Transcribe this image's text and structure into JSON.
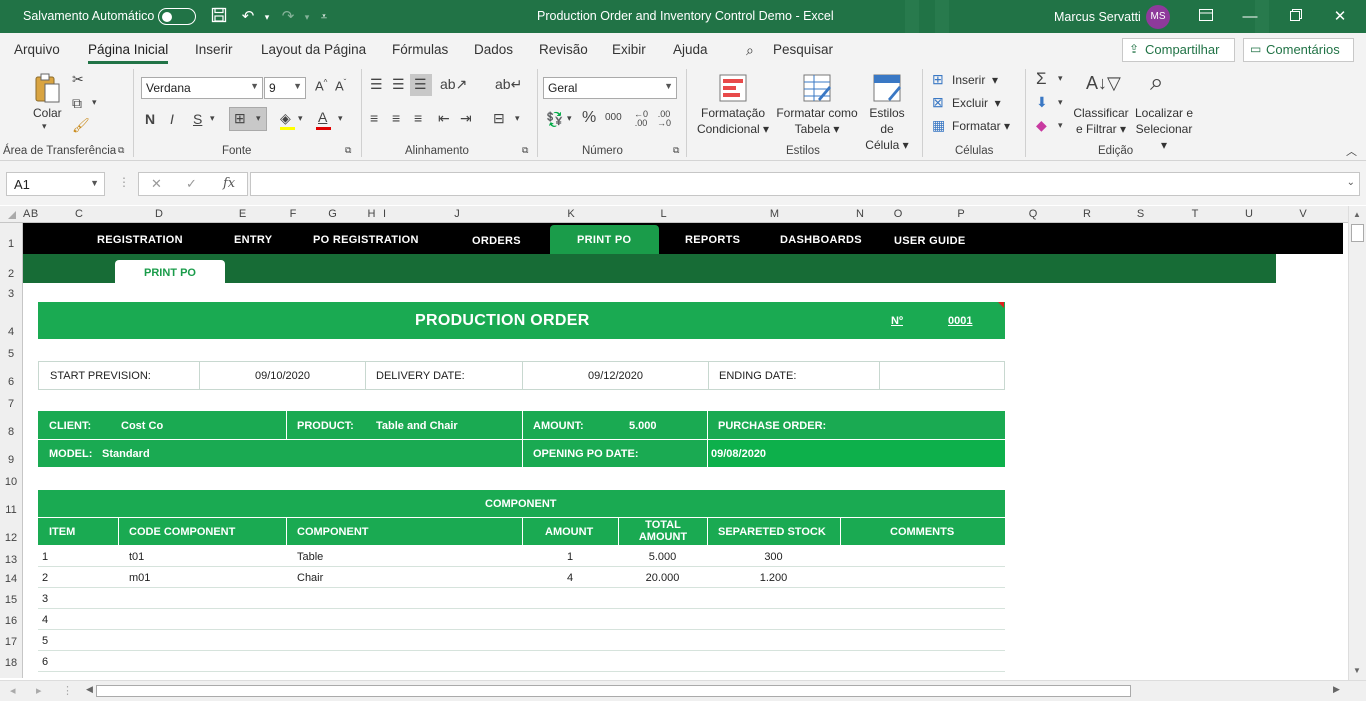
{
  "titlebar": {
    "autosave_label": "Salvamento Automático",
    "doc_title": "Production Order and Inventory Control Demo  -  Excel",
    "user_name": "Marcus Servatti",
    "user_initials": "MS"
  },
  "ribbon_tabs": [
    "Arquivo",
    "Página Inicial",
    "Inserir",
    "Layout da Página",
    "Fórmulas",
    "Dados",
    "Revisão",
    "Exibir",
    "Ajuda"
  ],
  "search_label": "Pesquisar",
  "share_label": "Compartilhar",
  "comments_label": "Comentários",
  "ribbon": {
    "paste_label": "Colar",
    "font_name": "Verdana",
    "font_size": "9",
    "bold": "N",
    "italic": "I",
    "underline": "S",
    "number_format": "Geral",
    "conditional_formatting": [
      "Formatação",
      "Condicional"
    ],
    "format_as_table": [
      "Formatar como",
      "Tabela"
    ],
    "cell_styles": [
      "Estilos de",
      "Célula"
    ],
    "insert": "Inserir",
    "delete": "Excluir",
    "format": "Formatar",
    "sort_filter": [
      "Classificar",
      "e Filtrar"
    ],
    "find_select": [
      "Localizar e",
      "Selecionar"
    ],
    "groups": {
      "clipboard": "Área de Transferência",
      "font": "Fonte",
      "alignment": "Alinhamento",
      "number": "Número",
      "styles": "Estilos",
      "cells": "Células",
      "editing": "Edição"
    }
  },
  "formula_bar": {
    "name_box": "A1",
    "formula": ""
  },
  "columns": [
    "A",
    "B",
    "C",
    "D",
    "E",
    "F",
    "G",
    "H",
    "I",
    "J",
    "K",
    "L",
    "M",
    "N",
    "O",
    "P",
    "Q",
    "R",
    "S",
    "T",
    "U",
    "V"
  ],
  "rows": [
    "1",
    "2",
    "3",
    "4",
    "5",
    "6",
    "7",
    "8",
    "9",
    "10",
    "11",
    "12",
    "13",
    "14",
    "15",
    "16",
    "17",
    "18"
  ],
  "nav": {
    "items": [
      "REGISTRATION",
      "ENTRY",
      "PO REGISTRATION",
      "ORDERS",
      "PRINT PO",
      "REPORTS",
      "DASHBOARDS",
      "USER GUIDE"
    ],
    "sub_tab": "PRINT PO"
  },
  "order": {
    "title": "PRODUCTION ORDER",
    "number_label": "Nº",
    "number_value": "0001",
    "start_label": "START PREVISION:",
    "start_value": "09/10/2020",
    "delivery_label": "DELIVERY DATE:",
    "delivery_value": "09/12/2020",
    "ending_label": "ENDING DATE:",
    "ending_value": "",
    "client_label": "CLIENT:",
    "client_value": "Cost Co",
    "product_label": "PRODUCT:",
    "product_value": "Table and Chair",
    "amount_label": "AMOUNT:",
    "amount_value": "5.000",
    "purchase_label": "PURCHASE ORDER:",
    "model_label": "MODEL:",
    "model_value": "Standard",
    "opening_label": "OPENING PO DATE:",
    "opening_value": "09/08/2020"
  },
  "component_table": {
    "title": "COMPONENT",
    "headers": [
      "ITEM",
      "CODE COMPONENT",
      "COMPONENT",
      "AMOUNT",
      "TOTAL AMOUNT",
      "SEPARETED STOCK",
      "COMMENTS"
    ],
    "rows": [
      [
        "1",
        "t01",
        "Table",
        "1",
        "5.000",
        "300",
        ""
      ],
      [
        "2",
        "m01",
        "Chair",
        "4",
        "20.000",
        "1.200",
        ""
      ],
      [
        "3",
        "",
        "",
        "",
        "",
        "",
        ""
      ],
      [
        "4",
        "",
        "",
        "",
        "",
        "",
        ""
      ],
      [
        "5",
        "",
        "",
        "",
        "",
        "",
        ""
      ],
      [
        "6",
        "",
        "",
        "",
        "",
        "",
        ""
      ]
    ]
  }
}
